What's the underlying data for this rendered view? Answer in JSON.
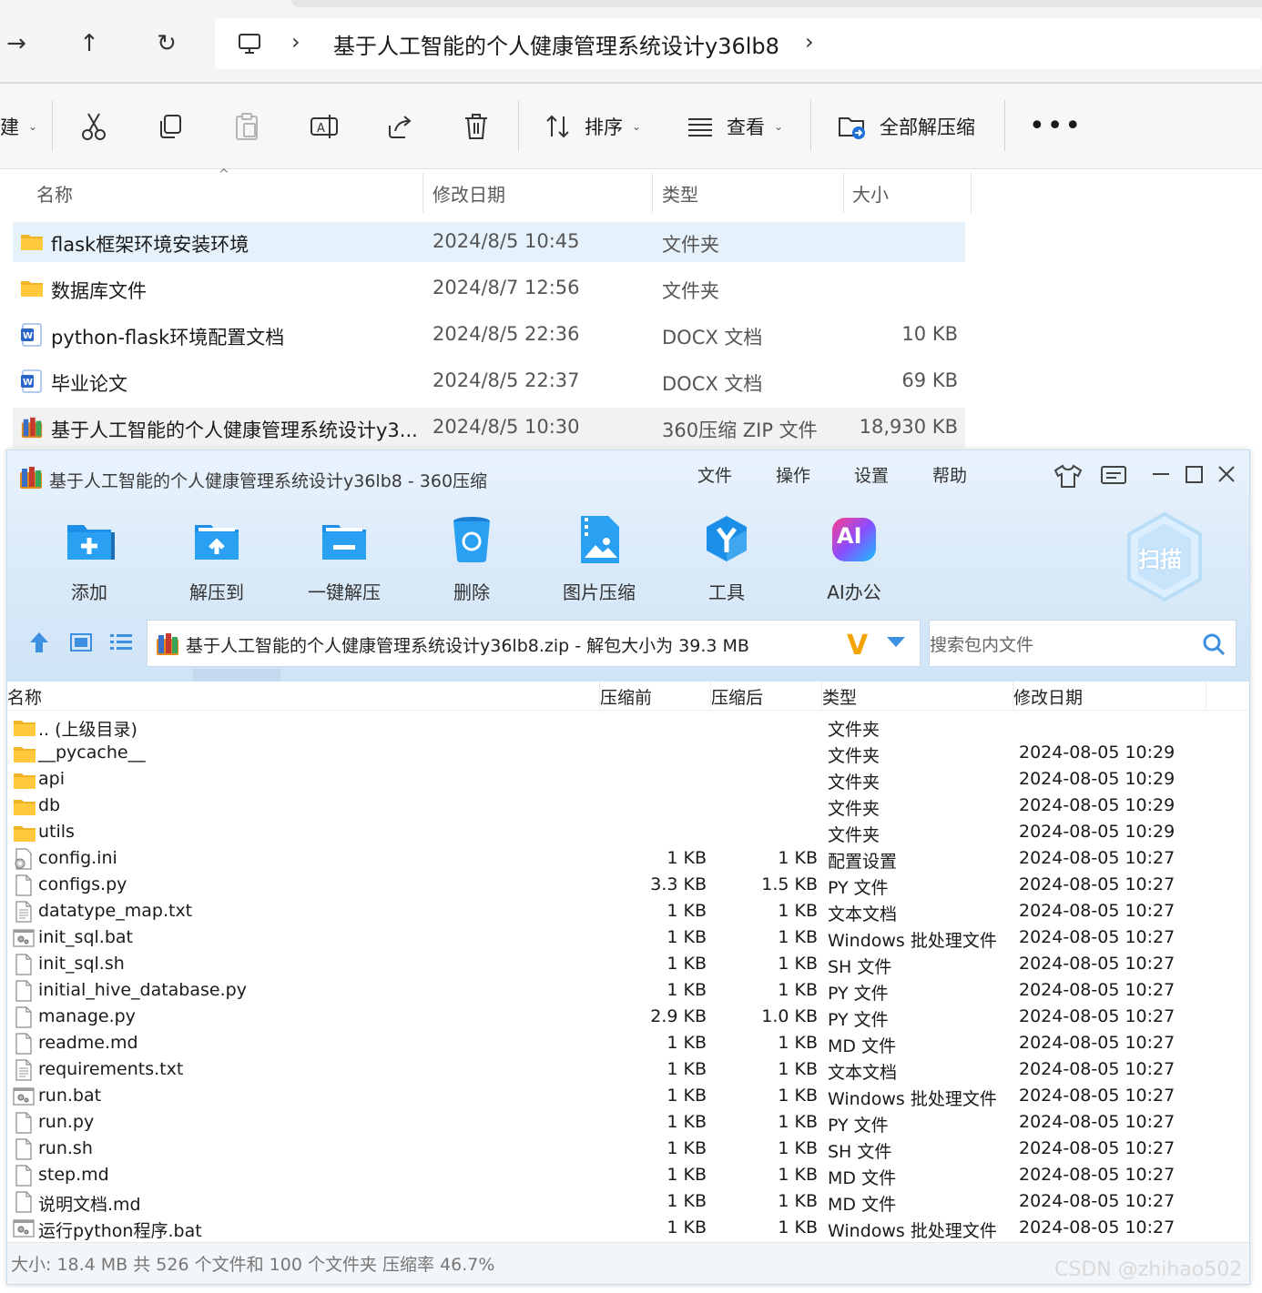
{
  "explorer": {
    "breadcrumb": "基于人工智能的个人健康管理系统设计y36lb8",
    "commands": {
      "sort": "排序",
      "view": "查看",
      "extract_all": "全部解压缩",
      "partial_new": "建"
    },
    "columns": {
      "name": "名称",
      "date": "修改日期",
      "type": "类型",
      "size": "大小"
    },
    "files": [
      {
        "name": "flask框架环境安装环境",
        "date": "2024/8/5 10:45",
        "type": "文件夹",
        "size": "",
        "icon": "folder-icon"
      },
      {
        "name": "数据库文件",
        "date": "2024/8/7 12:56",
        "type": "文件夹",
        "size": "",
        "icon": "folder-icon"
      },
      {
        "name": "python-flask环境配置文档",
        "date": "2024/8/5 22:36",
        "type": "DOCX 文档",
        "size": "10 KB",
        "icon": "word-doc-icon"
      },
      {
        "name": "毕业论文",
        "date": "2024/8/5 22:37",
        "type": "DOCX 文档",
        "size": "69 KB",
        "icon": "word-doc-icon"
      },
      {
        "name": "基于人工智能的个人健康管理系统设计y3...",
        "date": "2024/8/5 10:30",
        "type": "360压缩 ZIP 文件",
        "size": "18,930 KB",
        "icon": "zip-archive-icon"
      }
    ]
  },
  "archiver": {
    "title": "基于人工智能的个人健康管理系统设计y36lb8 - 360压缩",
    "menu": [
      "文件",
      "操作",
      "设置",
      "帮助"
    ],
    "tools": [
      "添加",
      "解压到",
      "一键解压",
      "删除",
      "图片压缩",
      "工具",
      "AI办公"
    ],
    "ai_badge": "AI",
    "scan_label": "扫描",
    "path": "基于人工智能的个人健康管理系统设计y36lb8.zip - 解包大小为 39.3 MB",
    "v_logo": "V",
    "search_placeholder": "搜索包内文件",
    "columns": {
      "name": "名称",
      "before": "压缩前",
      "after": "压缩后",
      "type": "类型",
      "date": "修改日期"
    },
    "rows": [
      {
        "name": ".. (上级目录)",
        "before": "",
        "after": "",
        "type": "文件夹",
        "date": "",
        "icon": "folder-icon"
      },
      {
        "name": "__pycache__",
        "before": "",
        "after": "",
        "type": "文件夹",
        "date": "2024-08-05 10:29",
        "icon": "folder-icon"
      },
      {
        "name": "api",
        "before": "",
        "after": "",
        "type": "文件夹",
        "date": "2024-08-05 10:29",
        "icon": "folder-icon"
      },
      {
        "name": "db",
        "before": "",
        "after": "",
        "type": "文件夹",
        "date": "2024-08-05 10:29",
        "icon": "folder-icon"
      },
      {
        "name": "utils",
        "before": "",
        "after": "",
        "type": "文件夹",
        "date": "2024-08-05 10:29",
        "icon": "folder-icon"
      },
      {
        "name": "config.ini",
        "before": "1 KB",
        "after": "1 KB",
        "type": "配置设置",
        "date": "2024-08-05 10:27",
        "icon": "settings-file-icon"
      },
      {
        "name": "configs.py",
        "before": "3.3 KB",
        "after": "1.5 KB",
        "type": "PY 文件",
        "date": "2024-08-05 10:27",
        "icon": "file-icon"
      },
      {
        "name": "datatype_map.txt",
        "before": "1 KB",
        "after": "1 KB",
        "type": "文本文档",
        "date": "2024-08-05 10:27",
        "icon": "text-file-icon"
      },
      {
        "name": "init_sql.bat",
        "before": "1 KB",
        "after": "1 KB",
        "type": "Windows 批处理文件",
        "date": "2024-08-05 10:27",
        "icon": "batch-file-icon"
      },
      {
        "name": "init_sql.sh",
        "before": "1 KB",
        "after": "1 KB",
        "type": "SH 文件",
        "date": "2024-08-05 10:27",
        "icon": "file-icon"
      },
      {
        "name": "initial_hive_database.py",
        "before": "1 KB",
        "after": "1 KB",
        "type": "PY 文件",
        "date": "2024-08-05 10:27",
        "icon": "file-icon"
      },
      {
        "name": "manage.py",
        "before": "2.9 KB",
        "after": "1.0 KB",
        "type": "PY 文件",
        "date": "2024-08-05 10:27",
        "icon": "file-icon"
      },
      {
        "name": "readme.md",
        "before": "1 KB",
        "after": "1 KB",
        "type": "MD 文件",
        "date": "2024-08-05 10:27",
        "icon": "file-icon"
      },
      {
        "name": "requirements.txt",
        "before": "1 KB",
        "after": "1 KB",
        "type": "文本文档",
        "date": "2024-08-05 10:27",
        "icon": "text-file-icon"
      },
      {
        "name": "run.bat",
        "before": "1 KB",
        "after": "1 KB",
        "type": "Windows 批处理文件",
        "date": "2024-08-05 10:27",
        "icon": "batch-file-icon"
      },
      {
        "name": "run.py",
        "before": "1 KB",
        "after": "1 KB",
        "type": "PY 文件",
        "date": "2024-08-05 10:27",
        "icon": "file-icon"
      },
      {
        "name": "run.sh",
        "before": "1 KB",
        "after": "1 KB",
        "type": "SH 文件",
        "date": "2024-08-05 10:27",
        "icon": "file-icon"
      },
      {
        "name": "step.md",
        "before": "1 KB",
        "after": "1 KB",
        "type": "MD 文件",
        "date": "2024-08-05 10:27",
        "icon": "file-icon"
      },
      {
        "name": "说明文档.md",
        "before": "1 KB",
        "after": "1 KB",
        "type": "MD 文件",
        "date": "2024-08-05 10:27",
        "icon": "file-icon"
      },
      {
        "name": "运行python程序.bat",
        "before": "1 KB",
        "after": "1 KB",
        "type": "Windows 批处理文件",
        "date": "2024-08-05 10:27",
        "icon": "batch-file-icon"
      }
    ],
    "status": "大小: 18.4 MB 共 526 个文件和 100 个文件夹 压缩率 46.7%"
  },
  "watermark": "CSDN @zhihao502"
}
